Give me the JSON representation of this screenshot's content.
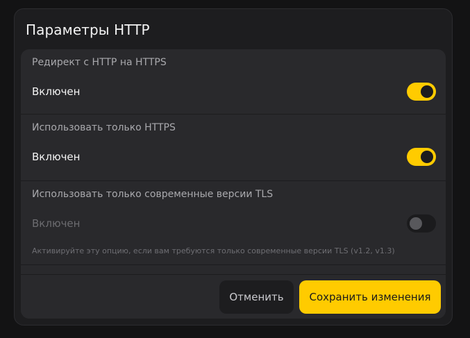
{
  "dialog": {
    "title": "Параметры HTTP"
  },
  "settings": [
    {
      "title": "Редирект с HTTP на HTTPS",
      "label": "Включен",
      "enabled": true
    },
    {
      "title": "Использовать только HTTPS",
      "label": "Включен",
      "enabled": true
    },
    {
      "title": "Использовать только современные версии TLS",
      "label": "Включен",
      "enabled": false,
      "hint": "Активируйте эту опцию, если вам требуются только современные версии TLS (v1.2, v1.3)"
    }
  ],
  "footer": {
    "cancel_label": "Отменить",
    "save_label": "Сохранить изменения"
  },
  "colors": {
    "accent": "#ffcb00",
    "background": "#131314",
    "card": "#1d1d1f",
    "panel": "#29292c"
  }
}
